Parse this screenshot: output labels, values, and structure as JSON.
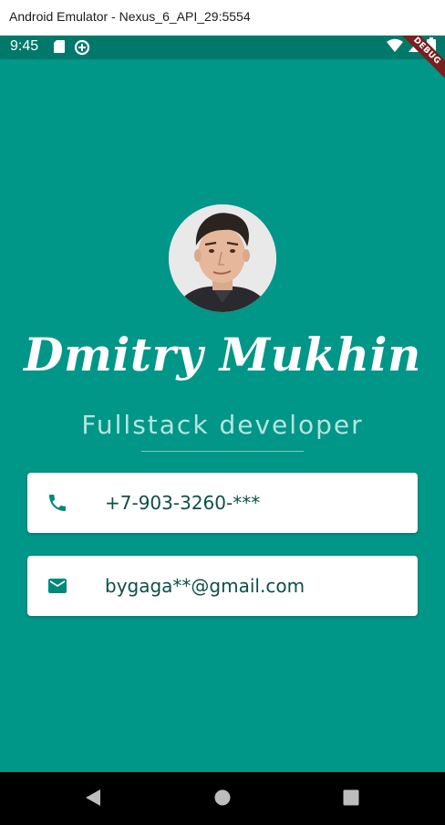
{
  "window": {
    "title": "Android Emulator - Nexus_6_API_29:5554"
  },
  "status_bar": {
    "time": "9:45",
    "icons": [
      "sd-card-icon",
      "data-saver-icon",
      "wifi-icon",
      "signal-icon",
      "battery-icon"
    ],
    "debug_banner": "DEBUG"
  },
  "profile": {
    "name": "Dmitry Mukhin",
    "role": "Fullstack developer"
  },
  "contacts": {
    "phone": "+7-903-3260-***",
    "email": "bygaga**@gmail.com"
  },
  "nav": {
    "buttons": [
      "back-icon",
      "home-icon",
      "recents-icon"
    ]
  },
  "colors": {
    "background": "#009688",
    "status_bar": "#00796b",
    "card": "#ffffff",
    "icon": "#00897b",
    "role_text": "#b7e4df"
  }
}
